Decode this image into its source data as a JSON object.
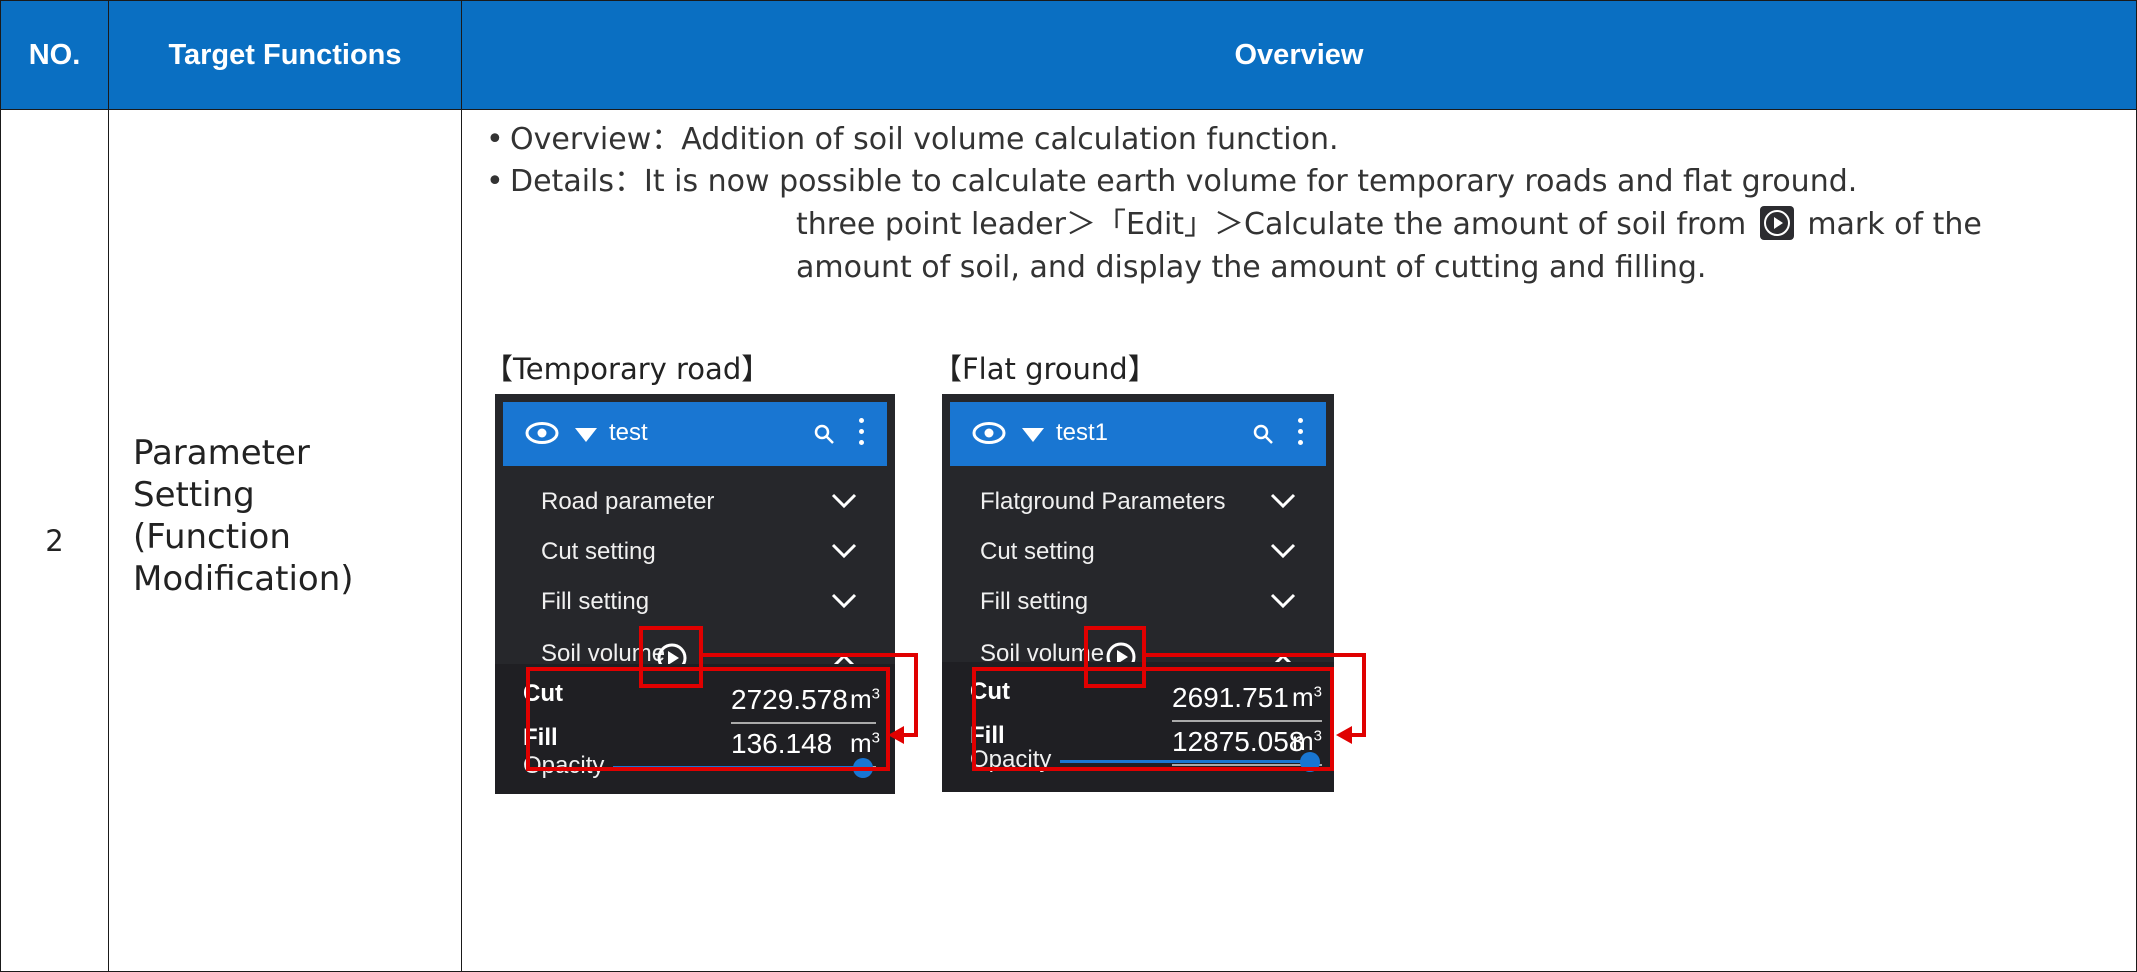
{
  "table": {
    "headers": {
      "no": "NO.",
      "target": "Target Functions",
      "overview": "Overview"
    },
    "row": {
      "no": "2",
      "target_lines": [
        "Parameter",
        "Setting",
        "(Function",
        "Modification)"
      ],
      "bullet1": "Overview：Addition of soil volume calculation function.",
      "bullet2": "Details：It is now possible to calculate earth volume for temporary roads and flat ground.",
      "bullet2_line2_a": "three point leader＞「Edit」＞Calculate the amount of soil from",
      "bullet2_line2_b": "mark of the",
      "bullet2_line3": "amount of soil, and display the amount of cutting and filling."
    }
  },
  "panels": [
    {
      "title": "【Temporary road】",
      "name": "test",
      "rows": [
        "Road parameter",
        "Cut setting",
        "Fill setting",
        "Soil volume"
      ],
      "cut_label": "Cut",
      "cut_value": "2729.578",
      "fill_label": "Fill",
      "fill_value": "136.148",
      "unit": "m",
      "unit_sup": "3",
      "opacity_label": "Opacity",
      "opacity_level": 1.0
    },
    {
      "title": "【Flat ground】",
      "name": "test1",
      "rows": [
        "Flatground Parameters",
        "Cut setting",
        "Fill setting",
        "Soil volume"
      ],
      "cut_label": "Cut",
      "cut_value": "2691.751",
      "fill_label": "Fill",
      "fill_value": "12875.058",
      "unit": "m",
      "unit_sup": "3",
      "opacity_label": "Opacity",
      "opacity_level": 1.0
    }
  ],
  "colors": {
    "header_blue": "#0a6fc2",
    "panel_dark": "#26272b",
    "panel_head": "#1976d2",
    "highlight_red": "#e00000"
  }
}
